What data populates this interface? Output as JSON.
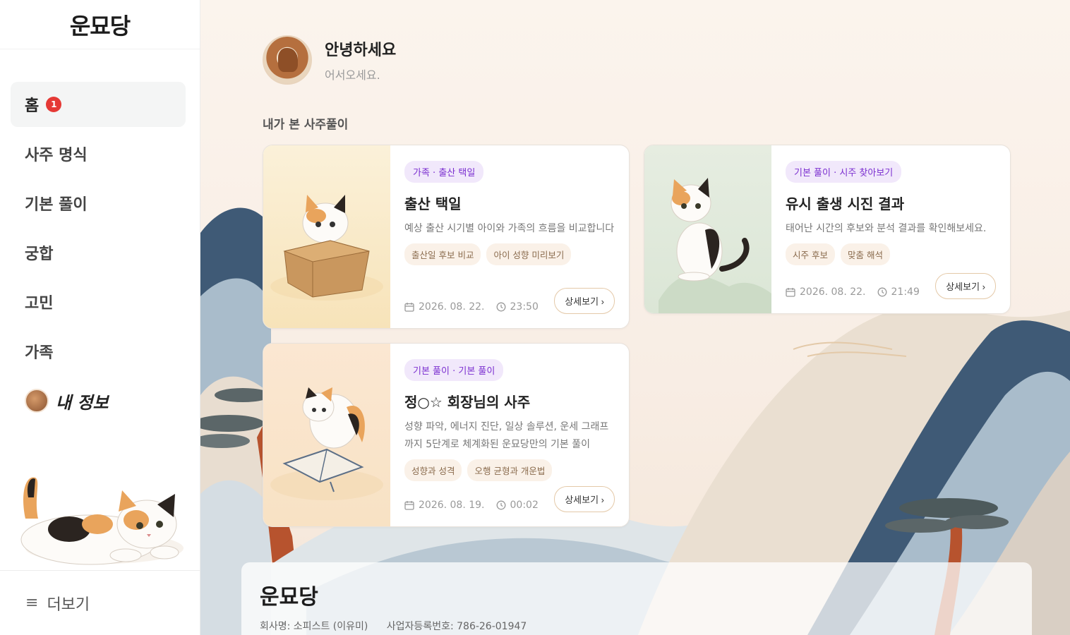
{
  "brand": {
    "logo_text": "운묘당"
  },
  "sidebar": {
    "items": [
      {
        "label": "홈",
        "badge": "1"
      },
      {
        "label": "사주 명식"
      },
      {
        "label": "기본 풀이"
      },
      {
        "label": "궁합"
      },
      {
        "label": "고민"
      },
      {
        "label": "가족"
      }
    ],
    "my_info_label": "내 정보",
    "more_label": "더보기"
  },
  "profile": {
    "greeting": "안녕하세요",
    "subtext": "어서오세요."
  },
  "section_title": "내가 본 사주풀이",
  "cards": [
    {
      "category": "가족 · 출산 택일",
      "title": "출산 택일",
      "description": "예상 출산 시기별 아이와 가족의 흐름을 비교합니다",
      "tags": [
        "출산일 후보 비교",
        "아이 성향 미리보기"
      ],
      "date": "2026. 08. 22.",
      "time": "23:50",
      "button": "상세보기 ›"
    },
    {
      "category": "기본 풀이 · 시주 찾아보기",
      "title": "유시 출생 시진 결과",
      "description": "태어난 시간의 후보와 분석 결과를 확인해보세요.",
      "tags": [
        "시주 후보",
        "맞춤 해석"
      ],
      "date": "2026. 08. 22.",
      "time": "21:49",
      "button": "상세보기 ›"
    },
    {
      "category": "기본 풀이 · 기본 풀이",
      "title": "정○☆ 회장님의 사주",
      "description": "성향 파악, 에너지 진단, 일상 솔루션, 운세 그래프까지 5단계로 체계화된 운묘당만의 기본 풀이",
      "tags": [
        "성향과 성격",
        "오행 균형과 개운법"
      ],
      "date": "2026. 08. 19.",
      "time": "00:02",
      "button": "상세보기 ›"
    }
  ],
  "footer": {
    "logo_text": "운묘당",
    "company": "회사명: 소피스트 (이유미)",
    "business_no": "사업자등록번호: 786-26-01947"
  },
  "colors": {
    "accent_purple": "#7b2fd0",
    "badge_red": "#e53935",
    "brand_orange": "#d28b3c"
  }
}
